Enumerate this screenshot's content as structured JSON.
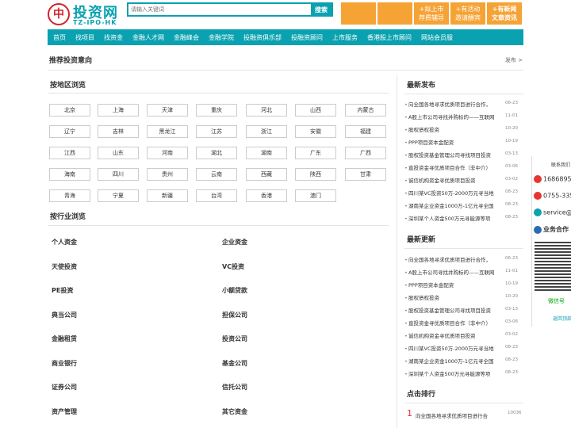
{
  "header": {
    "logo_mark": "中",
    "logo_cn": "投资网",
    "logo_en": "TZ-IPO-HK",
    "search_placeholder": "请输入关键词",
    "search_button": "搜索",
    "boxes": [
      {
        "line1": "",
        "line2": ""
      },
      {
        "line1": "",
        "line2": ""
      },
      {
        "line1": "+拟上市",
        "line2": "荐费辅导"
      },
      {
        "line1": "+有活动",
        "line2": "邀请酬宾"
      },
      {
        "line1": "+有新闻",
        "line2": "文章资讯"
      }
    ]
  },
  "nav": [
    "首页",
    "找项目",
    "找资金",
    "金融人才网",
    "金融峰会",
    "金融学院",
    "投融资俱乐部",
    "投融资顾问",
    "上市服务",
    "香港股上市顾问",
    "网站会员服"
  ],
  "recommend": {
    "title": "推荐投资意向",
    "more": "发布 >"
  },
  "regions": {
    "title": "按地区浏览",
    "items": [
      "北京",
      "上海",
      "天津",
      "重庆",
      "河北",
      "山西",
      "内蒙古",
      "辽宁",
      "吉林",
      "黑龙江",
      "江苏",
      "浙江",
      "安徽",
      "福建",
      "江西",
      "山东",
      "河南",
      "湖北",
      "湖南",
      "广东",
      "广西",
      "海南",
      "四川",
      "贵州",
      "云南",
      "西藏",
      "陕西",
      "甘肃",
      "青海",
      "宁夏",
      "新疆",
      "台湾",
      "香港",
      "澳门"
    ]
  },
  "industries": {
    "title": "按行业浏览",
    "left": [
      "个人资金",
      "天使投资",
      "PE投资",
      "典当公司",
      "金融租赁",
      "商业银行",
      "证券公司",
      "资产管理"
    ],
    "right": [
      "企业资金",
      "VC投资",
      "小额贷款",
      "担保公司",
      "投资公司",
      "基金公司",
      "信托公司",
      "其它资金"
    ]
  },
  "latest_publish": {
    "title": "最新发布",
    "items": [
      {
        "text": "向全国各地寻求优质项目进行合作，",
        "date": "06-23"
      },
      {
        "text": "A股上市公司寻找并购标的——互联网",
        "date": "11-01"
      },
      {
        "text": "股权债权投资",
        "date": "10-20"
      },
      {
        "text": "PPP项目资本金配资",
        "date": "10-19"
      },
      {
        "text": "股权投资基金管理公司寻找项目投资",
        "date": "03-13"
      },
      {
        "text": "直投资金寻优质项目合作（非中介）",
        "date": "03-06"
      },
      {
        "text": "诚信机构资金寻优质项目投资",
        "date": "03-02"
      },
      {
        "text": "四川某VC投资50万-2000万元寻当地",
        "date": "08-23"
      },
      {
        "text": "湖南某企业资金1000万-1亿元寻全国",
        "date": "08-23"
      },
      {
        "text": "深圳某个人资金500万元寻能源等项",
        "date": "08-23"
      }
    ]
  },
  "latest_update": {
    "title": "最新更新",
    "items": [
      {
        "text": "向全国各地寻求优质项目进行合作，",
        "date": "06-23"
      },
      {
        "text": "A股上市公司寻找并购标的——互联网",
        "date": "11-01"
      },
      {
        "text": "PPP项目资本金配资",
        "date": "10-19"
      },
      {
        "text": "股权债权投资",
        "date": "10-20"
      },
      {
        "text": "股权投资基金管理公司寻找项目投资",
        "date": "03-13"
      },
      {
        "text": "直投资金寻优质项目合作（非中介）",
        "date": "03-06"
      },
      {
        "text": "诚信机构资金寻优质项目投资",
        "date": "03-02"
      },
      {
        "text": "四川某VC投资50万-2000万元寻当地",
        "date": "08-23"
      },
      {
        "text": "湖南某企业资金1000万-1亿元寻全国",
        "date": "08-23"
      },
      {
        "text": "深圳某个人资金500万元寻能源等项",
        "date": "08-23"
      }
    ]
  },
  "ranking": {
    "title": "点击排行",
    "items": [
      {
        "rank": "1",
        "text": "向全国各地寻求优质项目进行合",
        "count": "10036"
      }
    ]
  },
  "float": {
    "title": "联系我们",
    "phone1": "1686895",
    "phone2": "0755-335",
    "email": "service@",
    "business": "业务合作",
    "wechat": "微信号",
    "top": "返回顶部"
  },
  "colors": {
    "teal": "#0aa1b0",
    "orange": "#f6a336",
    "red": "#e8352e"
  }
}
